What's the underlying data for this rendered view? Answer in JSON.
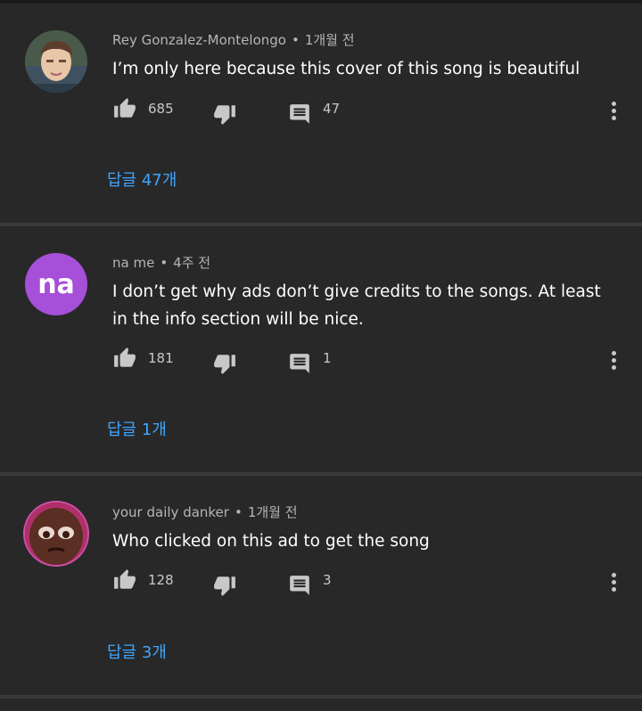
{
  "comments": [
    {
      "author": "Rey Gonzalez-Montelongo",
      "time": "1개월 전",
      "text": "I’m only here because this cover of this song is beautiful",
      "likes": "685",
      "replies_count": "47",
      "replies_label": "답글 47개",
      "avatar_type": "photo-person"
    },
    {
      "author": "na me",
      "time": "4주 전",
      "text": "I don’t get why ads don’t give credits to the songs. At least in the info section will be nice.",
      "likes": "181",
      "replies_count": "1",
      "replies_label": "답글 1개",
      "avatar_initials": "na",
      "avatar_color": "#a64fd9"
    },
    {
      "author": "your daily danker",
      "time": "1개월 전",
      "text": "Who clicked on this ad to get the song",
      "likes": "128",
      "replies_count": "3",
      "replies_label": "답글 3개",
      "avatar_type": "photo-face"
    }
  ],
  "separator": "•",
  "colors": {
    "background": "#282828",
    "reply_link": "#3ea6ff",
    "meta_text": "#b5b5b5"
  },
  "icons": [
    "like-icon",
    "dislike-icon",
    "reply-icon",
    "more-options-icon"
  ]
}
